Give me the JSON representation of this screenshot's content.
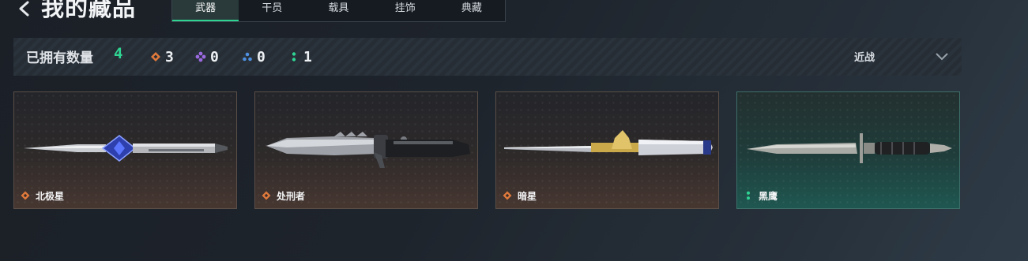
{
  "header": {
    "back_icon": "chevron-left-icon",
    "title": "我的藏品",
    "tabs": [
      {
        "label": "武器",
        "active": true
      },
      {
        "label": "干员",
        "active": false
      },
      {
        "label": "载具",
        "active": false
      },
      {
        "label": "挂饰",
        "active": false
      },
      {
        "label": "典藏",
        "active": false
      }
    ]
  },
  "summary": {
    "owned_label": "已拥有数量",
    "owned_count": "4",
    "rarity_counts": [
      {
        "icon": "orange-diamond-icon",
        "color": "#e07a3c",
        "value": "3"
      },
      {
        "icon": "purple-diamond-icon",
        "color": "#9b6ae0",
        "value": "0"
      },
      {
        "icon": "blue-triangle-icon",
        "color": "#4e8fe0",
        "value": "0"
      },
      {
        "icon": "green-dots-icon",
        "color": "#2fd493",
        "value": "1"
      }
    ],
    "filter_label": "近战",
    "filter_icon": "chevron-down-icon"
  },
  "items": [
    {
      "name": "北极星",
      "rarity": "orange",
      "icon": "orange-diamond-icon"
    },
    {
      "name": "处刑者",
      "rarity": "orange",
      "icon": "orange-diamond-icon"
    },
    {
      "name": "暗星",
      "rarity": "orange",
      "icon": "orange-diamond-icon"
    },
    {
      "name": "黑鹰",
      "rarity": "green",
      "icon": "green-dots-icon"
    }
  ],
  "colors": {
    "accent": "#2fd493",
    "orange": "#e07a3c",
    "purple": "#9b6ae0",
    "blue": "#4e8fe0"
  }
}
